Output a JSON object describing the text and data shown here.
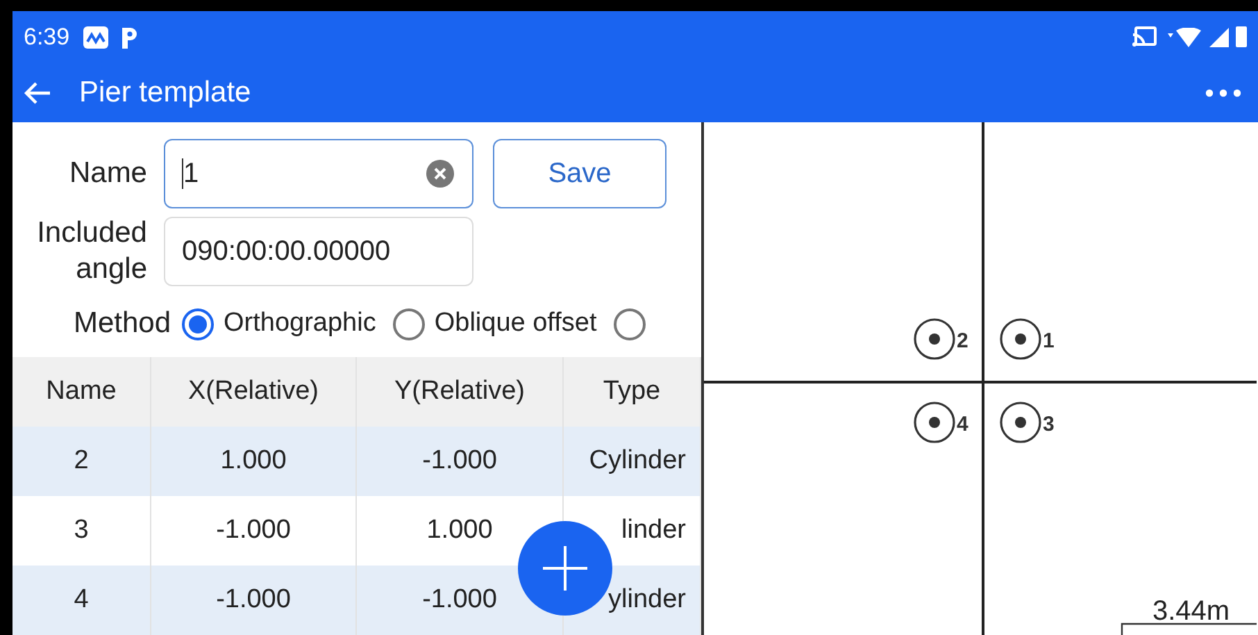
{
  "status_bar": {
    "time": "6:39"
  },
  "app_bar": {
    "title": "Pier template"
  },
  "form": {
    "name_label": "Name",
    "name_value": "1",
    "save": "Save",
    "angle_label": "Included angle",
    "angle_value": "090:00:00.00000",
    "method_label": "Method",
    "methods": [
      {
        "label": "Orthographic",
        "selected": true
      },
      {
        "label": "Oblique offset",
        "selected": false
      },
      {
        "selected": false
      }
    ]
  },
  "table": {
    "columns": [
      "Name",
      "X(Relative)",
      "Y(Relative)",
      "Type"
    ],
    "rows": [
      [
        "2",
        "1.000",
        "-1.000",
        "Cylinder"
      ],
      [
        "3",
        "-1.000",
        "1.000",
        "linder"
      ],
      [
        "4",
        "-1.000",
        "-1.000",
        "ylinder"
      ]
    ]
  },
  "map": {
    "piers": [
      {
        "label": "2"
      },
      {
        "label": "1"
      },
      {
        "label": "4"
      },
      {
        "label": "3"
      }
    ],
    "scale": "3.44m"
  }
}
